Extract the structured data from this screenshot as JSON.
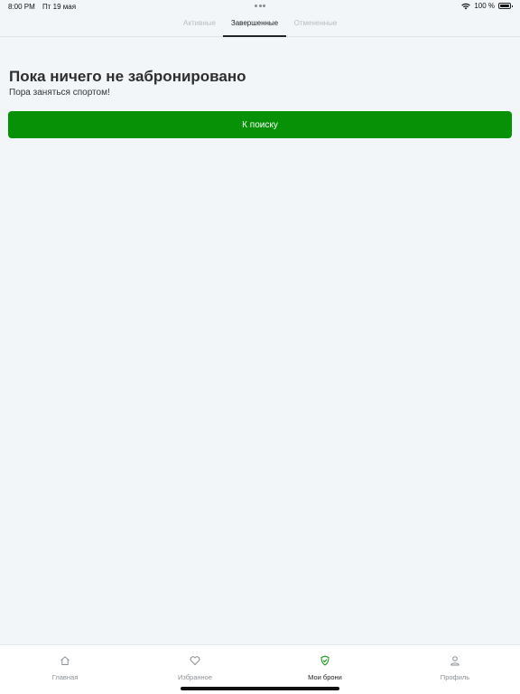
{
  "status_bar": {
    "time": "8:00 PM",
    "date": "Пт 19 мая",
    "battery_percent": "100 %"
  },
  "tabs": [
    {
      "label": "Активные",
      "active": false
    },
    {
      "label": "Завершенные",
      "active": true
    },
    {
      "label": "Отмененные",
      "active": false
    }
  ],
  "empty_state": {
    "title": "Пока ничего не забронировано",
    "subtitle": "Пора заняться спортом!",
    "button_label": "К поиску"
  },
  "bottom_nav": [
    {
      "label": "Главная",
      "icon": "home-icon",
      "active": false
    },
    {
      "label": "Избранное",
      "icon": "heart-icon",
      "active": false
    },
    {
      "label": "Мои брони",
      "icon": "shield-check-icon",
      "active": true
    },
    {
      "label": "Профиль",
      "icon": "user-icon",
      "active": false
    }
  ],
  "colors": {
    "accent": "#069106",
    "background": "#f3f6f9"
  }
}
